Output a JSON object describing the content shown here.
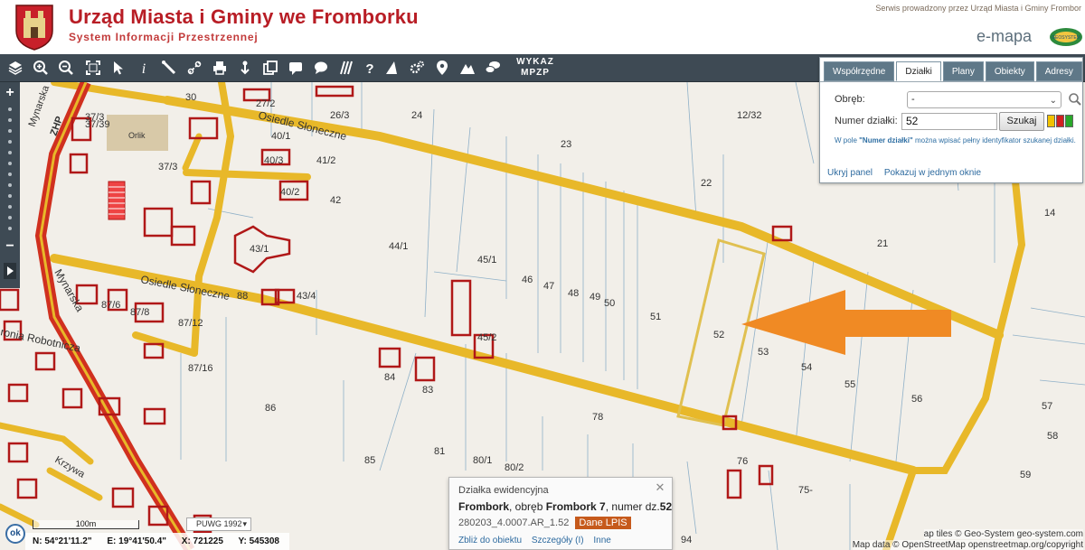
{
  "header": {
    "title": "Urząd Miasta i Gminy we Fromborku",
    "subtitle": "System Informacji Przestrzennej",
    "service_text": "Serwis prowadzony przez Urząd Miasta i Gminy Frombor",
    "emapa": "e-mapa",
    "emapa_logo_text": "GEOSYSTEM"
  },
  "toolbar": {
    "wykaz_line1": "WYKAZ",
    "wykaz_line2": "MPZP",
    "icons": [
      "layers-icon",
      "zoom-in-icon",
      "zoom-out-icon",
      "zoom-extent-icon",
      "select-pointer-icon",
      "info-icon",
      "measure-distance-icon",
      "measure-link-icon",
      "print-icon",
      "download-icon",
      "copy-icon",
      "speech-bubble-icon",
      "hatch-icon",
      "help-icon",
      "triangle-icon",
      "settings-icon",
      "marker-icon",
      "mountain-icon",
      "comments-icon"
    ]
  },
  "zoombar": {
    "plus": "+",
    "minus": "−"
  },
  "panel": {
    "tabs": [
      "Współrzędne",
      "Działki",
      "Plany",
      "Obiekty",
      "Adresy"
    ],
    "active_tab": "Działki",
    "obreb_label": "Obręb:",
    "obreb_value": "-",
    "numer_label": "Numer działki:",
    "numer_value": "52",
    "search_button": "Szukaj",
    "hint": "W pole \"Numer działki\" można wpisać pełny identyfikator szukanej działki.",
    "hint_bold": "\"Numer działki\"",
    "hide_panel": "Ukryj panel",
    "show_in_window": "Pokazuj w jednym oknie",
    "colors": [
      "#f2c200",
      "#d22020",
      "#2aa82a"
    ]
  },
  "popup": {
    "heading": "Działka ewidencyjna",
    "town": "Frombork",
    "obreb_text": ", obręb ",
    "obreb": "Frombork 7",
    "numer_text": ", numer dz.",
    "numer": "52",
    "identifier": "280203_4.0007.AR_1.52",
    "lpis_button": "Dane LPIS",
    "links": [
      "Zbliż do obiektu",
      "Szczegóły (I)",
      "Inne"
    ],
    "close": "✕"
  },
  "map": {
    "parcel_labels": [
      "30",
      "27/2",
      "37/3",
      "37/39",
      "26/3",
      "24",
      "Orlik",
      "37/3",
      "40/1",
      "40/3",
      "41/2",
      "12/32",
      "23",
      "22",
      "40/2",
      "42",
      "14",
      "21",
      "44/1",
      "43/1",
      "45/1",
      "46",
      "47",
      "48",
      "49",
      "50",
      "51",
      "52",
      "53",
      "54",
      "55",
      "56",
      "57",
      "58",
      "59",
      "45/2",
      "84",
      "83",
      "86",
      "81",
      "85",
      "80/1",
      "80/2",
      "78",
      "76",
      "75-",
      "94",
      "87/6",
      "87/8",
      "87/12",
      "87/16",
      "43/4",
      "88",
      "Mynarska",
      "ZHP",
      "Mynarska",
      "Osiedle Słoneczne",
      "Osiedle Słoneczne",
      "ronia Robotnicza",
      "Krzywa"
    ],
    "scale_label": "100m",
    "projection": "PUWG 1992",
    "coords": {
      "n": "N: 54°21'11.2\"",
      "e": "E: 19°41'50.4\"",
      "x": "X: 721225",
      "y": "Y: 545308"
    },
    "attribution1": "ap tiles © Geo-System geo-system.com",
    "attribution2": "Map data © OpenStreetMap openstreetmap.org/copyright",
    "ok": "ok"
  }
}
